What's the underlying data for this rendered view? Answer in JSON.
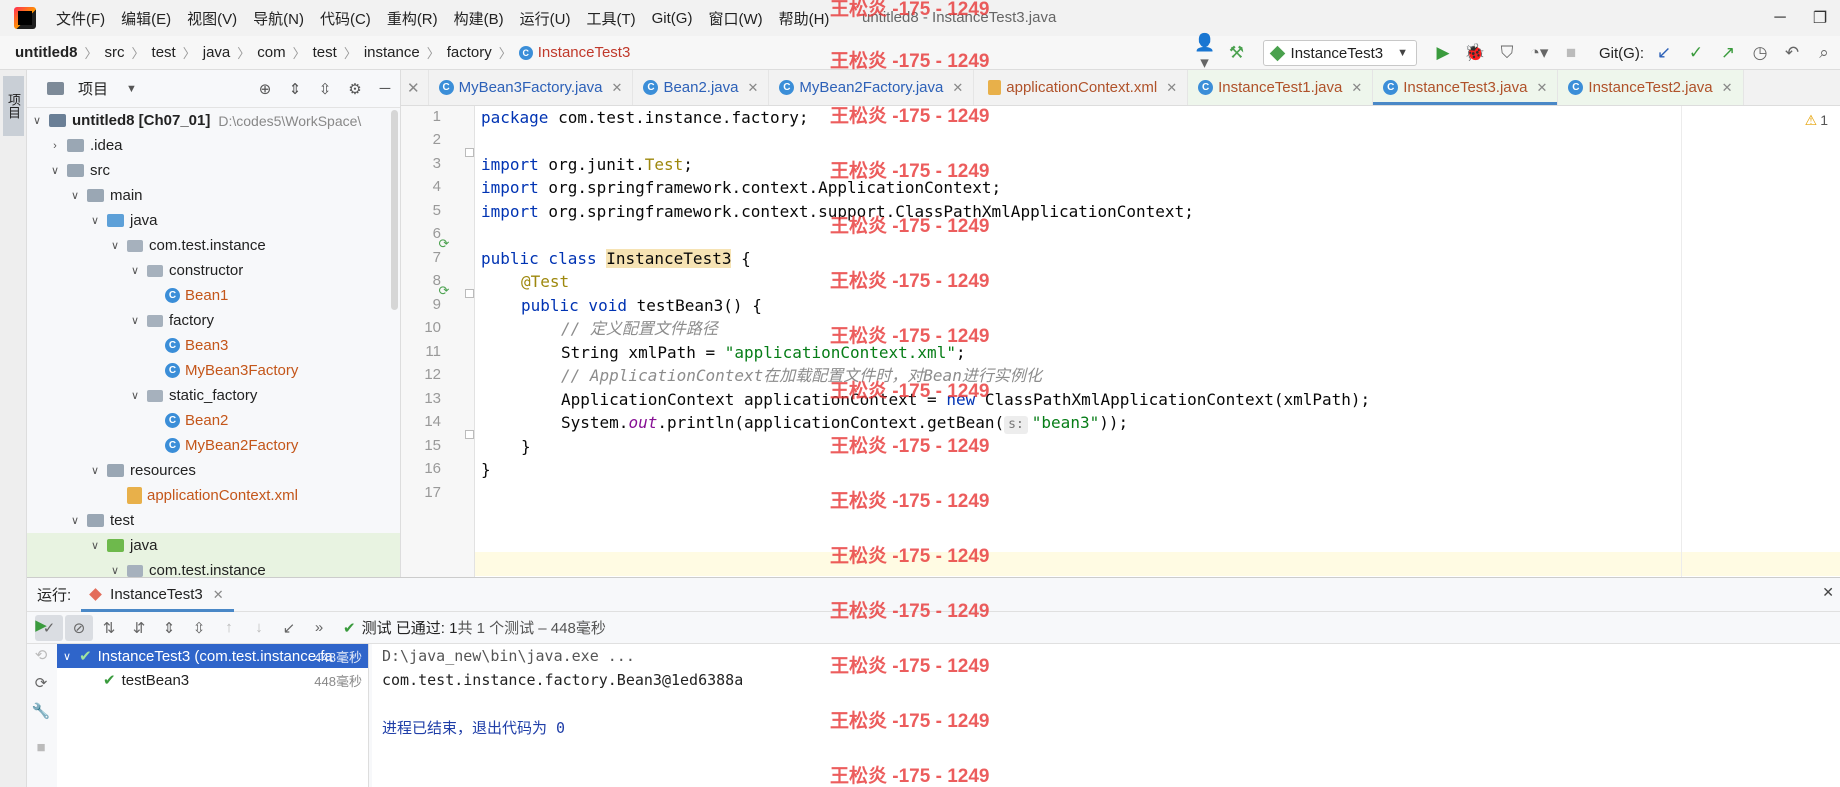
{
  "window": {
    "title": "untitled8 - InstanceTest3.java"
  },
  "menu": [
    "文件(F)",
    "编辑(E)",
    "视图(V)",
    "导航(N)",
    "代码(C)",
    "重构(R)",
    "构建(B)",
    "运行(U)",
    "工具(T)",
    "Git(G)",
    "窗口(W)",
    "帮助(H)"
  ],
  "breadcrumb": [
    "untitled8",
    "src",
    "test",
    "java",
    "com",
    "test",
    "instance",
    "factory",
    "InstanceTest3"
  ],
  "toolbar": {
    "run_config": "InstanceTest3",
    "git_label": "Git(G):"
  },
  "project_panel": {
    "title": "项目",
    "stripe_label": "项目",
    "tree": [
      {
        "label": "untitled8 [Ch07_01]",
        "extra": "D:\\codes5\\WorkSpace\\",
        "kind": "module"
      },
      {
        "label": ".idea",
        "kind": "folder"
      },
      {
        "label": "src",
        "kind": "folder"
      },
      {
        "label": "main",
        "kind": "folder"
      },
      {
        "label": "java",
        "kind": "src"
      },
      {
        "label": "com.test.instance",
        "kind": "pkg"
      },
      {
        "label": "constructor",
        "kind": "pkg"
      },
      {
        "label": "Bean1",
        "kind": "class"
      },
      {
        "label": "factory",
        "kind": "pkg"
      },
      {
        "label": "Bean3",
        "kind": "class"
      },
      {
        "label": "MyBean3Factory",
        "kind": "class"
      },
      {
        "label": "static_factory",
        "kind": "pkg"
      },
      {
        "label": "Bean2",
        "kind": "class"
      },
      {
        "label": "MyBean2Factory",
        "kind": "class"
      },
      {
        "label": "resources",
        "kind": "res"
      },
      {
        "label": "applicationContext.xml",
        "kind": "xml"
      },
      {
        "label": "test",
        "kind": "folder"
      },
      {
        "label": "java",
        "kind": "test"
      },
      {
        "label": "com.test.instance",
        "kind": "pkg"
      }
    ]
  },
  "tabs": [
    {
      "label": "MyBean3Factory.java",
      "icon": "class-icon"
    },
    {
      "label": "Bean2.java",
      "icon": "class-icon"
    },
    {
      "label": "MyBean2Factory.java",
      "icon": "class-icon"
    },
    {
      "label": "applicationContext.xml",
      "icon": "xml-icon"
    },
    {
      "label": "InstanceTest1.java",
      "icon": "class-icon"
    },
    {
      "label": "InstanceTest3.java",
      "icon": "class-icon",
      "active": true
    },
    {
      "label": "InstanceTest2.java",
      "icon": "class-icon"
    }
  ],
  "editor": {
    "line_numbers": [
      "1",
      "2",
      "3",
      "4",
      "5",
      "6",
      "7",
      "8",
      "9",
      "10",
      "11",
      "12",
      "13",
      "14",
      "15",
      "16",
      "17"
    ],
    "warnings": "1",
    "code": {
      "l1": {
        "kw": "package",
        "rest": " com.test.instance.factory;"
      },
      "l3": {
        "kw": "import",
        "pre": " org.junit.",
        "ann": "Test",
        "post": ";"
      },
      "l4": {
        "kw": "import",
        "rest": " org.springframework.context.ApplicationContext;"
      },
      "l5": {
        "kw": "import",
        "rest": " org.springframework.context.support.ClassPathXmlApplicationContext;"
      },
      "l7": {
        "kw": "public class",
        "cls": "InstanceTest3",
        "rest": " {"
      },
      "l8": {
        "ann": "@Test"
      },
      "l9": {
        "kw": "public void",
        "rest": " testBean3() {"
      },
      "l10": {
        "cmt": "// 定义配置文件路径"
      },
      "l11": {
        "pre": "String xmlPath = ",
        "str": "\"applicationContext.xml\"",
        "post": ";"
      },
      "l12": {
        "cmt": "// ApplicationContext在加载配置文件时，对Bean进行实例化"
      },
      "l13": {
        "pre": "ApplicationContext applicationContext = ",
        "kw": "new",
        "post": " ClassPathXmlApplicationContext(xmlPath);"
      },
      "l14": {
        "pre": "System.",
        "static": "out",
        "mid": ".println(applicationContext.getBean(",
        "hint": "s:",
        "str": "\"bean3\"",
        "post": "));"
      },
      "l15": {
        "rest": "}"
      },
      "l16": {
        "rest": "}"
      }
    }
  },
  "run_panel": {
    "label": "运行:",
    "tab": "InstanceTest3",
    "status_main": "测试 已通过: 1",
    "status_detail": "共 1 个测试 – 448毫秒",
    "tests": [
      {
        "label": "InstanceTest3 (com.test.instance.fa",
        "duration": "448毫秒"
      },
      {
        "label": "testBean3",
        "duration": "448毫秒"
      }
    ],
    "console": [
      "D:\\java_new\\bin\\java.exe ...",
      "com.test.instance.factory.Bean3@1ed6388a",
      "",
      "进程已结束，退出代码为 0"
    ]
  },
  "watermark": "王松炎 -175 - 1249"
}
